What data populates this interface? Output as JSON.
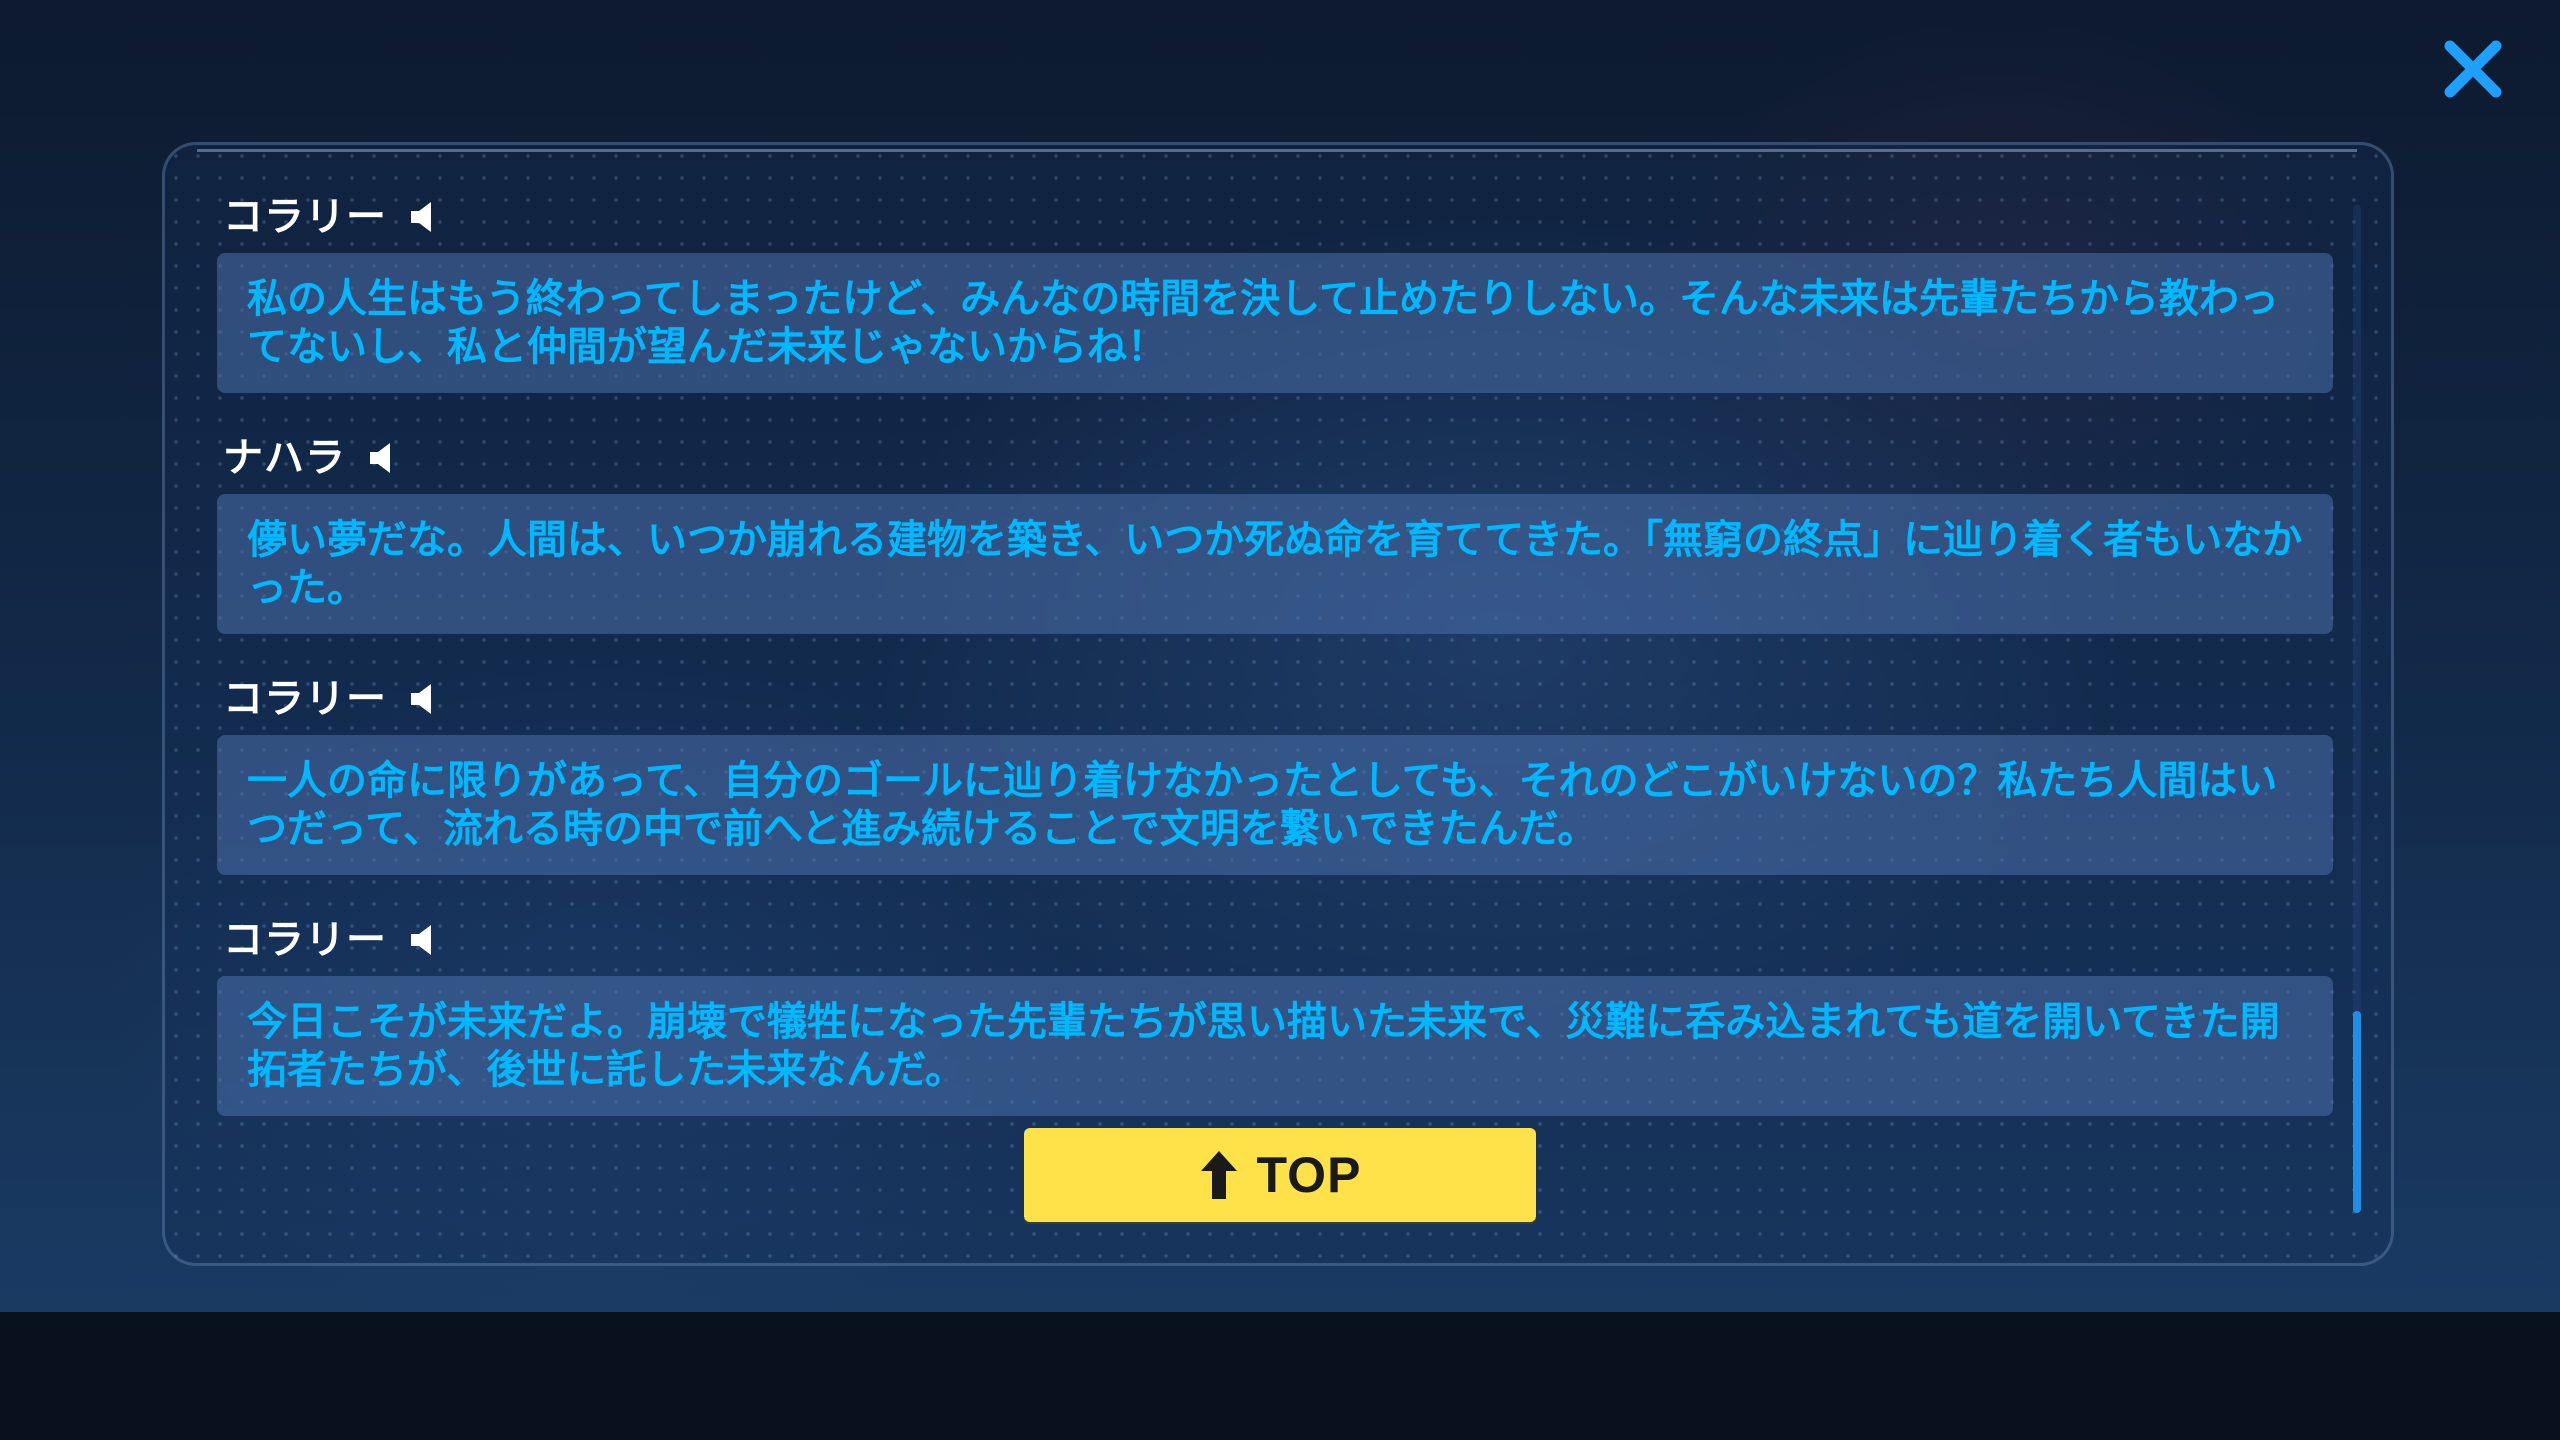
{
  "close_button": {
    "icon": "close-icon",
    "color": "#1fa0ff"
  },
  "dialogue_log": {
    "entries": [
      {
        "speaker": "コラリー",
        "voice_icon": "speaker-icon",
        "text": "私の人生はもう終わってしまったけど、みんなの時間を決して止めたりしない。そんな未来は先輩たちから教わってないし、私と仲間が望んだ未来じゃないからね！"
      },
      {
        "speaker": "ナハラ",
        "voice_icon": "speaker-icon",
        "text": "儚い夢だな。人間は、いつか崩れる建物を築き、いつか死ぬ命を育ててきた。「無窮の終点」に辿り着く者もいなかった。"
      },
      {
        "speaker": "コラリー",
        "voice_icon": "speaker-icon",
        "text": "一人の命に限りがあって、自分のゴールに辿り着けなかったとしても、それのどこがいけないの？私たち人間はいつだって、流れる時の中で前へと進み続けることで文明を繋いできたんだ。"
      },
      {
        "speaker": "コラリー",
        "voice_icon": "speaker-icon",
        "text": "今日こそが未来だよ。崩壊で犠牲になった先輩たちが思い描いた未来で、災難に呑み込まれても道を開いてきた開拓者たちが、後世に託した未来なんだ。"
      }
    ],
    "scroll_position": 0.86
  },
  "top_button": {
    "label": "TOP",
    "icon": "arrow-up-icon",
    "color": "#ffe14a"
  },
  "colors": {
    "speaker_name": "#ffffff",
    "dialogue_text": "#00b8ff",
    "dialogue_box": "#4a70aa",
    "scroll_thumb": "#1f8fe6"
  }
}
